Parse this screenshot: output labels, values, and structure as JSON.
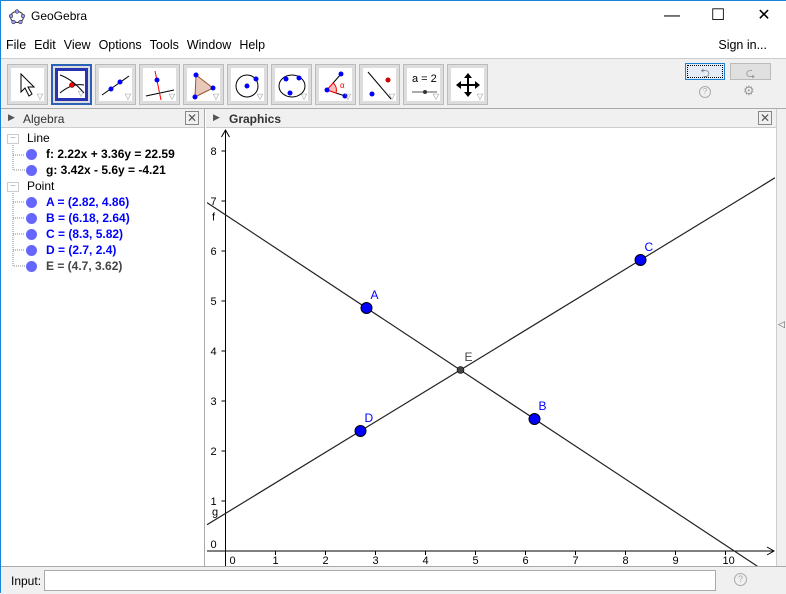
{
  "window": {
    "title": "GeoGebra",
    "minimize": "—",
    "maximize": "☐",
    "close": "✕"
  },
  "menu": [
    "File",
    "Edit",
    "View",
    "Options",
    "Tools",
    "Window",
    "Help"
  ],
  "sign_in": "Sign in...",
  "toolbar": {
    "tools": [
      "move",
      "intersect",
      "line",
      "perpendicular-line",
      "polygon",
      "circle-center-point",
      "circle-three-points",
      "angle",
      "reflect",
      "slider",
      "move-graphics-view"
    ],
    "selected": 1,
    "slider_label": "a = 2",
    "undo": "⮌",
    "redo": "⮎",
    "help": "?",
    "settings": "⚙"
  },
  "algebra": {
    "title": "Algebra",
    "groups": [
      {
        "label": "Line",
        "items": [
          {
            "text": "f: 2.22x + 3.36y = 22.59",
            "color": "#000000"
          },
          {
            "text": "g: 3.42x - 5.6y = -4.21",
            "color": "#000000"
          }
        ]
      },
      {
        "label": "Point",
        "items": [
          {
            "text": "A = (2.82, 4.86)",
            "color": "#0000ff"
          },
          {
            "text": "B = (6.18, 2.64)",
            "color": "#0000ff"
          },
          {
            "text": "C = (8.3, 5.82)",
            "color": "#0000ff"
          },
          {
            "text": "D = (2.7, 2.4)",
            "color": "#0000ff"
          },
          {
            "text": "E = (4.7, 3.62)",
            "color": "#444444"
          }
        ]
      }
    ]
  },
  "graphics": {
    "title": "Graphics"
  },
  "chart_data": {
    "type": "scatter",
    "xlim": [
      -0.37,
      11
    ],
    "ylim": [
      -0.3,
      8.46
    ],
    "x_ticks": [
      0,
      1,
      2,
      3,
      4,
      5,
      6,
      7,
      8,
      9,
      10
    ],
    "y_ticks": [
      0,
      1,
      2,
      3,
      4,
      5,
      6,
      7,
      8
    ],
    "lines": [
      {
        "name": "f",
        "a": 2.22,
        "b": 3.36,
        "c": 22.59
      },
      {
        "name": "g",
        "a": 3.42,
        "b": -5.6,
        "c": -4.21
      }
    ],
    "points": [
      {
        "name": "A",
        "x": 2.82,
        "y": 4.86,
        "color": "#0000ff",
        "size": "large"
      },
      {
        "name": "B",
        "x": 6.18,
        "y": 2.64,
        "color": "#0000ff",
        "size": "large"
      },
      {
        "name": "C",
        "x": 8.3,
        "y": 5.82,
        "color": "#0000ff",
        "size": "large"
      },
      {
        "name": "D",
        "x": 2.7,
        "y": 2.4,
        "color": "#0000ff",
        "size": "large"
      },
      {
        "name": "E",
        "x": 4.7,
        "y": 3.62,
        "color": "#444444",
        "size": "small"
      }
    ]
  },
  "input": {
    "label": "Input:",
    "value": "",
    "help": "?"
  }
}
